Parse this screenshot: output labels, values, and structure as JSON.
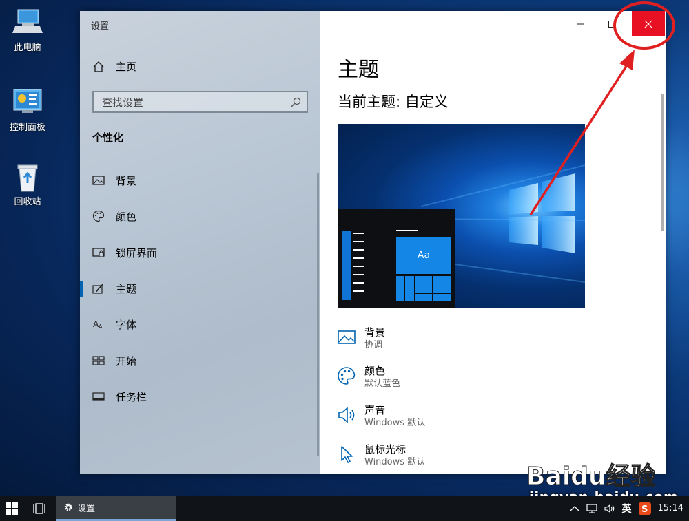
{
  "desktop": {
    "icons": [
      {
        "label": "此电脑"
      },
      {
        "label": "控制面板"
      },
      {
        "label": "回收站"
      }
    ]
  },
  "window": {
    "title": "设置",
    "home_label": "主页",
    "search_placeholder": "查找设置",
    "section_title": "个性化",
    "nav": [
      {
        "label": "背景",
        "icon": "picture-icon"
      },
      {
        "label": "颜色",
        "icon": "palette-icon"
      },
      {
        "label": "锁屏界面",
        "icon": "lock-screen-icon"
      },
      {
        "label": "主题",
        "icon": "theme-brush-icon",
        "active": true
      },
      {
        "label": "字体",
        "icon": "font-icon"
      },
      {
        "label": "开始",
        "icon": "start-tiles-icon"
      },
      {
        "label": "任务栏",
        "icon": "taskbar-icon"
      }
    ],
    "accent_color": "#0063b1",
    "close_color": "#e81123"
  },
  "main": {
    "page_title": "主题",
    "current_theme": "当前主题: 自定义",
    "preview_tile_text": "Aa",
    "options": [
      {
        "title": "背景",
        "subtitle": "协调",
        "icon": "picture-icon"
      },
      {
        "title": "颜色",
        "subtitle": "默认蓝色",
        "icon": "palette-icon"
      },
      {
        "title": "声音",
        "subtitle": "Windows 默认",
        "icon": "speaker-icon"
      },
      {
        "title": "鼠标光标",
        "subtitle": "Windows 默认",
        "icon": "cursor-icon"
      }
    ]
  },
  "taskbar": {
    "app_label": "设置",
    "ime_label": "英",
    "clock": "15:14"
  },
  "watermark": {
    "brand": "Baidu经验",
    "url": "jingyan.baidu.com"
  }
}
